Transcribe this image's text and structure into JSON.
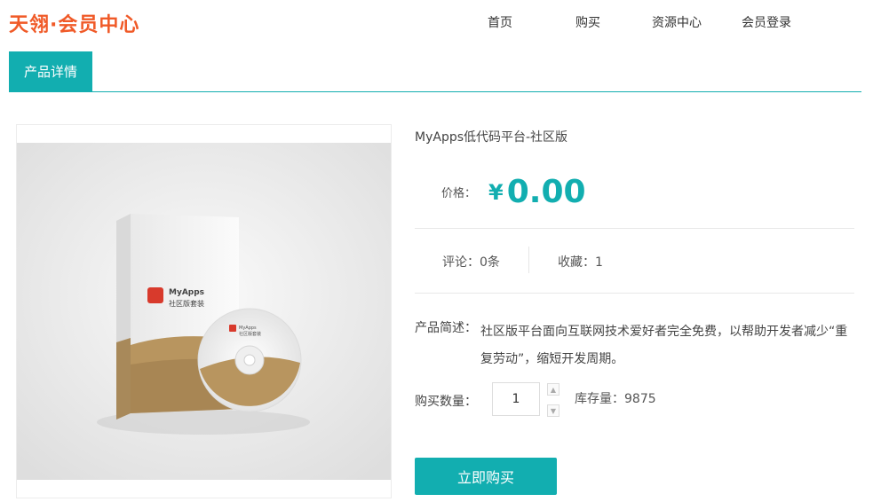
{
  "site": {
    "logo": "天翎·会员中心"
  },
  "nav": {
    "items": [
      "首页",
      "购买",
      "资源中心",
      "会员登录"
    ]
  },
  "tabs": {
    "active": "产品详情"
  },
  "product": {
    "title": "MyApps低代码平台-社区版",
    "price_label": "价格：",
    "currency": "¥",
    "price": "0.00",
    "comments": "评论：0条",
    "favorites": "收藏：1",
    "desc_label": "产品简述：",
    "description": "社区版平台面向互联网技术爱好者完全免费，以帮助开发者减少“重复劳动”，缩短开发周期。",
    "qty_label": "购买数量：",
    "qty_value": "1",
    "stock": "库存量：9875",
    "buy_label": "立即购买",
    "box_text_1": "MyApps",
    "box_text_2": "社区版套装",
    "disc_text_1": "MyApps",
    "disc_text_2": "社区版套装"
  },
  "colors": {
    "accent": "#12aeb0",
    "logo": "#f05a28"
  },
  "icons": {
    "up": "caret-up-icon",
    "down": "caret-down-icon"
  }
}
